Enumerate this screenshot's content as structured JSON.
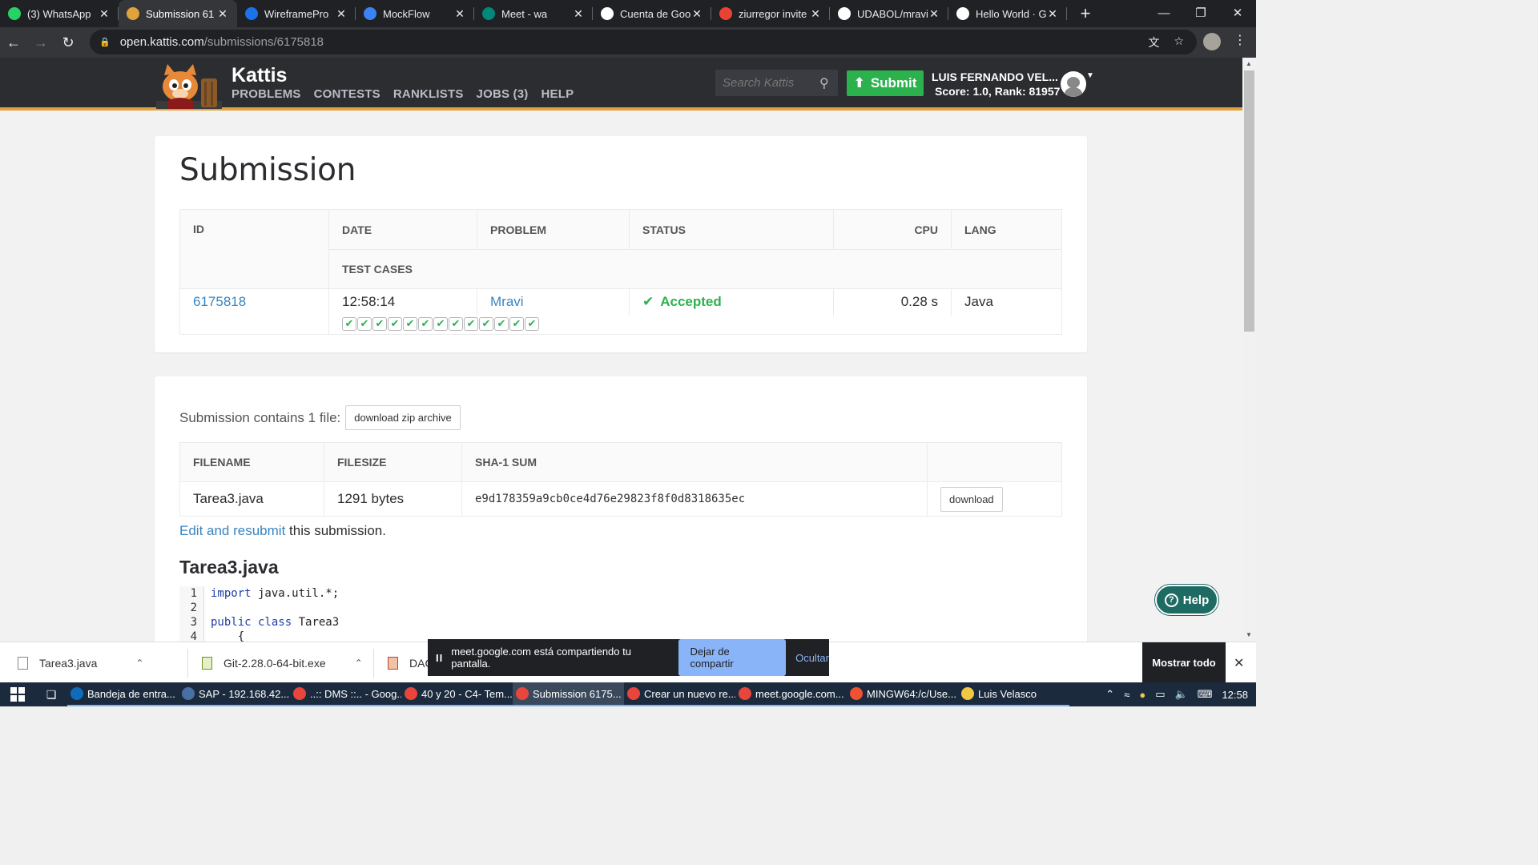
{
  "browser": {
    "tabs": [
      {
        "title": "(3) WhatsApp",
        "icon": "whatsapp-icon",
        "color": "#25d366"
      },
      {
        "title": "Submission 61",
        "icon": "kattis-icon",
        "color": "#e0a23a",
        "active": true
      },
      {
        "title": "WireframePro",
        "icon": "wireframepro-icon",
        "color": "#1a73e8"
      },
      {
        "title": "MockFlow",
        "icon": "mockflow-icon",
        "color": "#3b82f6"
      },
      {
        "title": "Meet - wa",
        "icon": "meet-icon",
        "color": "#00897b"
      },
      {
        "title": "Cuenta de Goo",
        "icon": "google-icon",
        "color": "#ffffff"
      },
      {
        "title": "ziurregor invite",
        "icon": "gmail-icon",
        "color": "#ea4335"
      },
      {
        "title": "UDABOL/mravi",
        "icon": "github-icon",
        "color": "#ffffff"
      },
      {
        "title": "Hello World · G",
        "icon": "github-icon",
        "color": "#ffffff"
      }
    ],
    "url_host": "open.kattis.com",
    "url_path": "/submissions/6175818"
  },
  "site": {
    "brand": "Kattis",
    "nav": [
      "PROBLEMS",
      "CONTESTS",
      "RANKLISTS",
      "JOBS (3)",
      "HELP"
    ],
    "search_placeholder": "Search Kattis",
    "submit_label": "Submit",
    "user_name": "LUIS FERNANDO VEL...",
    "user_score": "Score: 1.0, Rank: 81957"
  },
  "submission": {
    "title": "Submission",
    "headers": {
      "id": "ID",
      "date": "DATE",
      "problem": "PROBLEM",
      "status": "STATUS",
      "cpu": "CPU",
      "lang": "LANG",
      "test_cases": "TEST CASES"
    },
    "id": "6175818",
    "date": "12:58:14",
    "problem": "Mravi",
    "status": "Accepted",
    "cpu": "0.28 s",
    "lang": "Java",
    "test_cases_passed": 13
  },
  "files": {
    "contains_text": "Submission contains 1 file:",
    "download_zip": "download zip archive",
    "headers": {
      "filename": "FILENAME",
      "filesize": "FILESIZE",
      "sha1": "SHA-1 SUM"
    },
    "rows": [
      {
        "filename": "Tarea3.java",
        "filesize": "1291 bytes",
        "sha1": "e9d178359a9cb0ce4d76e29823f8f0d8318635ec",
        "download": "download"
      }
    ],
    "resubmit_link": "Edit and resubmit",
    "resubmit_rest": " this submission."
  },
  "code": {
    "filename": "Tarea3.java",
    "lines": [
      {
        "n": "1",
        "kw": "import",
        "rest": " java.util.*;"
      },
      {
        "n": "2",
        "kw": "",
        "rest": ""
      },
      {
        "n": "3",
        "kw": "public class",
        "rest": " Tarea3"
      },
      {
        "n": "4",
        "kw": "",
        "rest": "    {"
      }
    ]
  },
  "help_button": "Help",
  "downloads": [
    {
      "name": "Tarea3.java"
    },
    {
      "name": "Git-2.28.0-64-bit.exe"
    },
    {
      "name": "DAC"
    }
  ],
  "share_banner": {
    "text": "meet.google.com está compartiendo tu pantalla.",
    "stop": "Dejar de compartir",
    "hide": "Ocultar"
  },
  "show_all": "Mostrar todo",
  "taskbar": {
    "apps": [
      {
        "title": "Bandeja de entra...",
        "color": "#0f6cbd"
      },
      {
        "title": "SAP - 192.168.42....",
        "color": "#4a6fa5"
      },
      {
        "title": "..:: DMS ::.. - Goog...",
        "color": "#e8453c"
      },
      {
        "title": "40 y 20 - C4- Tem...",
        "color": "#e8453c"
      },
      {
        "title": "Submission 6175...",
        "color": "#e8453c",
        "active": true
      },
      {
        "title": "Crear un nuevo re...",
        "color": "#e8453c"
      },
      {
        "title": "meet.google.com...",
        "color": "#e8453c"
      },
      {
        "title": "MINGW64:/c/Use...",
        "color": "#f05133"
      },
      {
        "title": "Luis Velasco",
        "color": "#f2c744"
      }
    ],
    "clock": "12:58"
  }
}
